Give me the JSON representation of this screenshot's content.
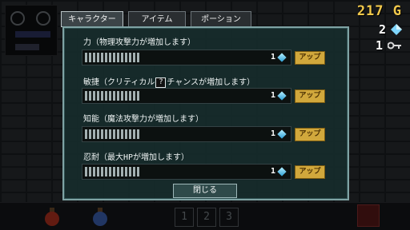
{
  "hud": {
    "gold": "217 G",
    "gems": "2",
    "keys": "1",
    "gold_color": "#f1c84b"
  },
  "tabs": [
    {
      "label": "キャラクター",
      "active": true
    },
    {
      "label": "アイテム",
      "active": false
    },
    {
      "label": "ポーション",
      "active": false
    }
  ],
  "stats": [
    {
      "label": "力（物理攻撃力が増加します）",
      "level": "1",
      "button": "アップ"
    },
    {
      "label_before": "敏捷（クリティカル",
      "label_help": "?",
      "label_after": "チャンスが増加します）",
      "level": "1",
      "button": "アップ"
    },
    {
      "label": "知能（魔法攻撃力が増加します）",
      "level": "1",
      "button": "アップ"
    },
    {
      "label": "忍耐（最大HPが増加します）",
      "level": "1",
      "button": "アップ"
    }
  ],
  "close_label": "閉じる",
  "bottom_slots": [
    "1",
    "2",
    "3"
  ]
}
